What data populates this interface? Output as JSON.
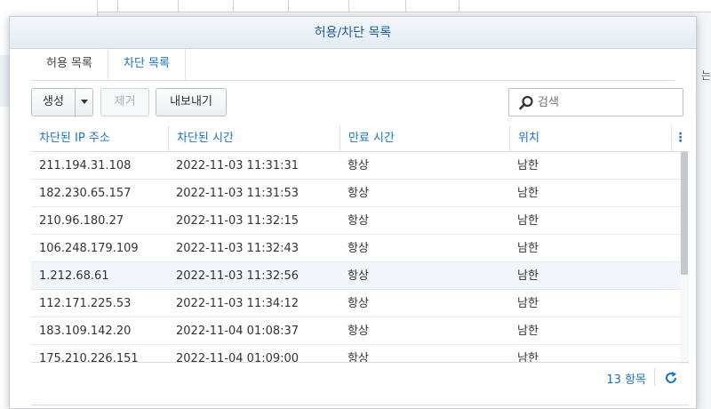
{
  "dialog": {
    "title": "허용/차단 목록",
    "tabs": [
      {
        "label": "허용 목록",
        "active": false
      },
      {
        "label": "차단 목록",
        "active": true
      }
    ]
  },
  "toolbar": {
    "create_label": "생성",
    "remove_label": "제거",
    "export_label": "내보내기",
    "search_placeholder": "검색"
  },
  "table": {
    "columns": [
      "차단된 IP 주소",
      "차단된 시간",
      "만료 시간",
      "위치"
    ],
    "rows": [
      {
        "ip": "211.194.31.108",
        "time": "2022-11-03 11:31:31",
        "expire": "항상",
        "location": "남한"
      },
      {
        "ip": "182.230.65.157",
        "time": "2022-11-03 11:31:53",
        "expire": "항상",
        "location": "남한"
      },
      {
        "ip": "210.96.180.27",
        "time": "2022-11-03 11:32:15",
        "expire": "항상",
        "location": "남한"
      },
      {
        "ip": "106.248.179.109",
        "time": "2022-11-03 11:32:43",
        "expire": "항상",
        "location": "남한"
      },
      {
        "ip": "1.212.68.61",
        "time": "2022-11-03 11:32:56",
        "expire": "항상",
        "location": "남한"
      },
      {
        "ip": "112.171.225.53",
        "time": "2022-11-03 11:34:12",
        "expire": "항상",
        "location": "남한"
      },
      {
        "ip": "183.109.142.20",
        "time": "2022-11-04 01:08:37",
        "expire": "항상",
        "location": "남한"
      },
      {
        "ip": "175.210.226.151",
        "time": "2022-11-04 01:09:00",
        "expire": "항상",
        "location": "남한"
      }
    ]
  },
  "footer": {
    "count": "13 항목"
  },
  "background": {
    "right_text": "는"
  },
  "colors": {
    "accent": "#1a73c4",
    "title": "#1f5f9e"
  }
}
